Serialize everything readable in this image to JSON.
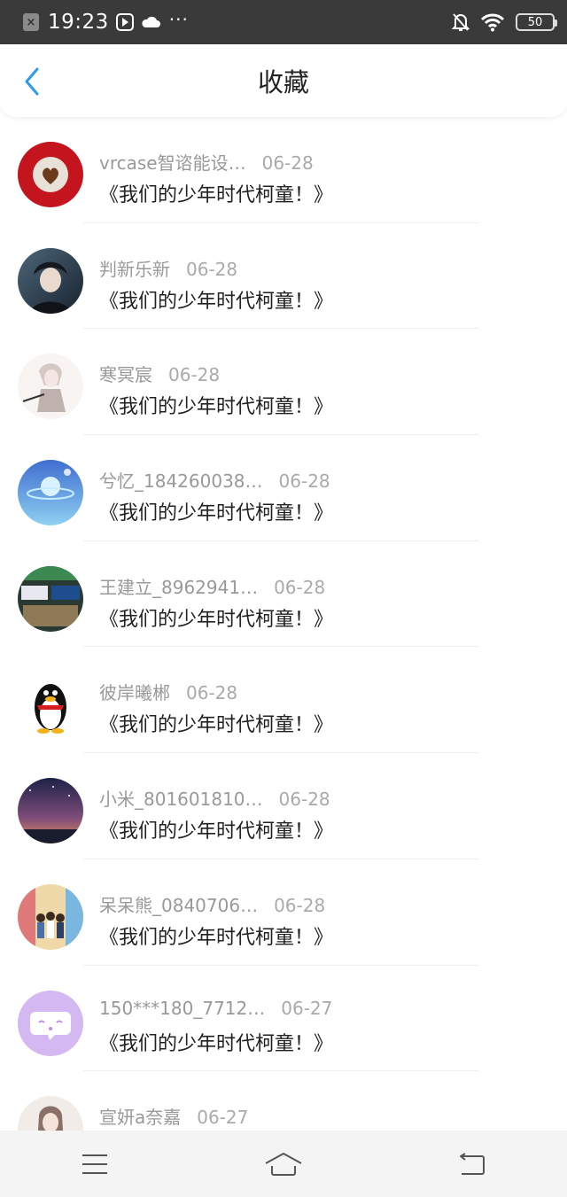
{
  "status_bar": {
    "time": "19:23",
    "dots": "···",
    "battery": "50",
    "icons": [
      "app-close-icon",
      "video-icon",
      "cloud-icon",
      "mute-bell-icon",
      "wifi-icon",
      "battery-icon"
    ]
  },
  "header": {
    "title": "收藏",
    "back_icon": "chevron-left-icon",
    "accent": "#2a9af3"
  },
  "items": [
    {
      "name": "vrcase智谘能设…",
      "date": "06-28",
      "title": "《我们的少年时代柯童！》",
      "avatar": "coffee-heart"
    },
    {
      "name": "判新乐新",
      "date": "06-28",
      "title": "《我们的少年时代柯童！》",
      "avatar": "anime-boy-dark"
    },
    {
      "name": "寒冥宸",
      "date": "06-28",
      "title": "《我们的少年时代柯童！》",
      "avatar": "anime-sketch"
    },
    {
      "name": "兮忆_184260038…",
      "date": "06-28",
      "title": "《我们的少年时代柯童！》",
      "avatar": "blue-planet"
    },
    {
      "name": "王建立_8962941…",
      "date": "06-28",
      "title": "《我们的少年时代柯童！》",
      "avatar": "shop-front"
    },
    {
      "name": "彼岸曦郴",
      "date": "06-28",
      "title": "《我们的少年时代柯童！》",
      "avatar": "qq-penguin"
    },
    {
      "name": "小米_801601810…",
      "date": "06-28",
      "title": "《我们的少年时代柯童！》",
      "avatar": "starry-sky"
    },
    {
      "name": "呆呆熊_0840706…",
      "date": "06-28",
      "title": "《我们的少年时代柯童！》",
      "avatar": "group-street"
    },
    {
      "name": "150***180_7712…",
      "date": "06-27",
      "title": "《我们的少年时代柯童！》",
      "avatar": "purple-chat"
    },
    {
      "name": "宣妍a奈嘉",
      "date": "06-27",
      "title": "",
      "avatar": "girl-portrait"
    }
  ],
  "nav": {
    "menu_icon": "menu-icon",
    "home_icon": "home-icon",
    "back_icon": "return-icon"
  }
}
